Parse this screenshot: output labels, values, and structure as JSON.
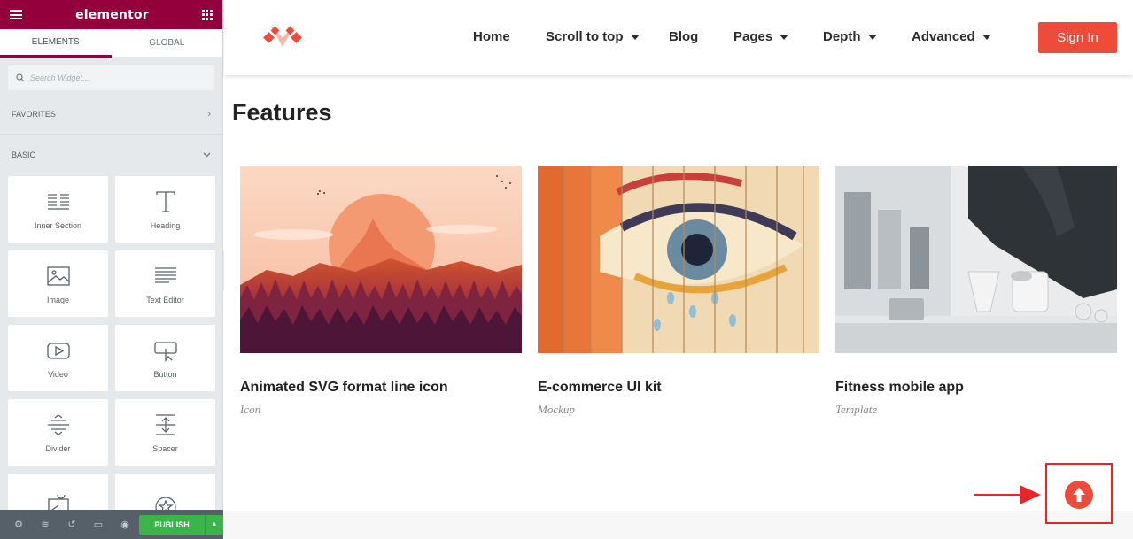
{
  "colors": {
    "brand": "#93003c",
    "accent": "#ee4b3a",
    "publish": "#39b54a",
    "highlight": "#e8262a"
  },
  "editor": {
    "title": "elementor",
    "tabs": [
      {
        "label": "ELEMENTS",
        "active": true
      },
      {
        "label": "GLOBAL",
        "active": false
      }
    ],
    "search_placeholder": "Search Widget...",
    "categories": {
      "favorites": "FAVORITES",
      "basic": "BASIC"
    },
    "widgets": [
      {
        "label": "Inner Section",
        "icon": "inner-section-icon"
      },
      {
        "label": "Heading",
        "icon": "heading-icon"
      },
      {
        "label": "Image",
        "icon": "image-icon"
      },
      {
        "label": "Text Editor",
        "icon": "text-editor-icon"
      },
      {
        "label": "Video",
        "icon": "video-icon"
      },
      {
        "label": "Button",
        "icon": "button-icon"
      },
      {
        "label": "Divider",
        "icon": "divider-icon"
      },
      {
        "label": "Spacer",
        "icon": "spacer-icon"
      },
      {
        "label": "",
        "icon": "google-maps-icon"
      },
      {
        "label": "",
        "icon": "star-icon"
      }
    ],
    "footer": {
      "publish_label": "PUBLISH"
    }
  },
  "site": {
    "nav": [
      {
        "label": "Home",
        "dropdown": false
      },
      {
        "label": "Scroll to top",
        "dropdown": true
      },
      {
        "label": "Blog",
        "dropdown": false
      },
      {
        "label": "Pages",
        "dropdown": true
      },
      {
        "label": "Depth",
        "dropdown": true
      },
      {
        "label": "Advanced",
        "dropdown": true
      }
    ],
    "signin_label": "Sign In",
    "section_title": "Features",
    "cards": [
      {
        "title": "Animated SVG format line icon",
        "tag": "Icon",
        "image": "mountain-sunset-illustration"
      },
      {
        "title": "E-commerce UI kit",
        "tag": "Mockup",
        "image": "painted-wood-eye-mural"
      },
      {
        "title": "Fitness mobile app",
        "tag": "Template",
        "image": "barista-pour-over-coffee"
      }
    ],
    "scroll_top_icon": "arrow-up-icon"
  }
}
